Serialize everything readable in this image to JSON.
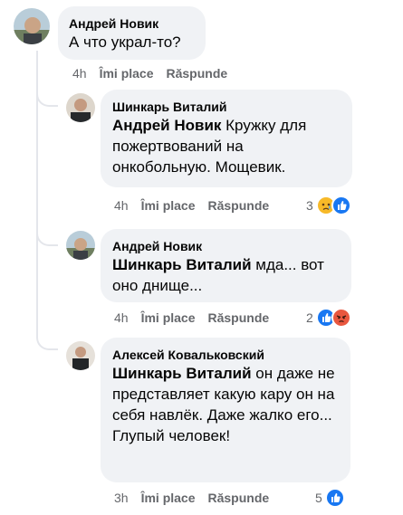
{
  "comments": [
    {
      "author": "Андрей Новик",
      "mention": "",
      "text": "А что украл-то?",
      "time": "4h",
      "like": "Îmi place",
      "reply": "Răspunde",
      "reaction_count": "",
      "reactions": []
    },
    {
      "author": "Шинкарь Виталий",
      "mention": "Андрей Новик",
      "text": "Кружку для пожертвований на онкобольную. Мощевик.",
      "time": "4h",
      "like": "Îmi place",
      "reply": "Răspunde",
      "reaction_count": "3",
      "reactions": [
        "sad-emoji-icon",
        "like-icon"
      ]
    },
    {
      "author": "Андрей Новик",
      "mention": "Шинкарь Виталий",
      "text": "мда... вот оно днище...",
      "time": "4h",
      "like": "Îmi place",
      "reply": "Răspunde",
      "reaction_count": "2",
      "reactions": [
        "like-icon",
        "angry-emoji-icon"
      ]
    },
    {
      "author": "Алексей Ковальковский",
      "mention": "Шинкарь Виталий",
      "text": "он даже не представляет какую кару он на себя навлёк. Даже жалко его...",
      "text2": "Глупый человек!",
      "time": "3h",
      "like": "Îmi place",
      "reply": "Răspunde",
      "reaction_count": "5",
      "reactions": [
        "like-icon"
      ]
    }
  ],
  "colors": {
    "bubble": "#f0f2f5",
    "meta": "#65676b",
    "like_blue": "#1877f2",
    "angry_red": "#e9573f",
    "sad_yellow": "#f7b928"
  }
}
